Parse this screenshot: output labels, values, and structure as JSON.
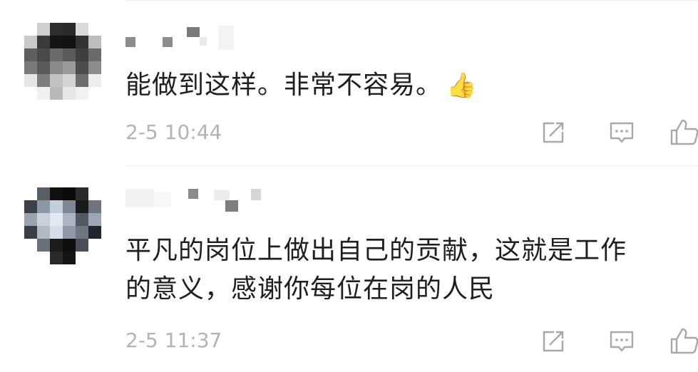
{
  "comments": [
    {
      "text_lines": [
        "能做到这样。非常不容易。"
      ],
      "emoji": "👍",
      "emoji_icon": "thumbs-up-emoji-icon",
      "timestamp": "2-5 10:44",
      "actions": [
        "share-icon",
        "reply-icon",
        "like-icon"
      ]
    },
    {
      "text_lines": [
        "平凡的岗位上做出自己的贡献，这就是工作",
        "的意义，感谢你每位在岗的人民"
      ],
      "timestamp": "2-5 11:37",
      "actions": [
        "share-icon",
        "reply-icon",
        "like-icon"
      ]
    }
  ],
  "colors": {
    "text": "#1f1f1f",
    "meta": "#b3b3b3",
    "icon": "#a8a8a8",
    "divider": "#ededed"
  }
}
